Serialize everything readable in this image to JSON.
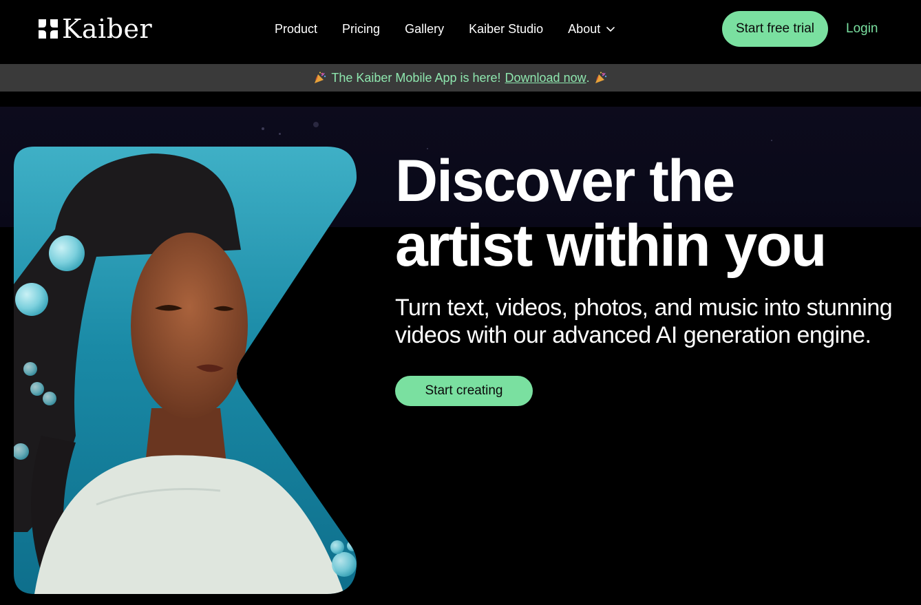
{
  "header": {
    "brand": "Kaiber",
    "nav": [
      {
        "label": "Product"
      },
      {
        "label": "Pricing"
      },
      {
        "label": "Gallery"
      },
      {
        "label": "Kaiber Studio"
      },
      {
        "label": "About",
        "icon": "chevron-down-icon"
      }
    ],
    "trial_label": "Start free trial",
    "login_label": "Login"
  },
  "announcement": {
    "text": "The Kaiber Mobile App is here!",
    "link_label": "Download now",
    "suffix": ".",
    "icon": "party-popper-icon"
  },
  "hero": {
    "headline_line1": "Discover the",
    "headline_line2": "artist within you",
    "subhead_line1": "Turn text, videos, photos, and music into stunning",
    "subhead_line2": "videos with our advanced AI generation engine.",
    "cta_label": "Start creating",
    "image_icon": "portrait-artwork-image"
  },
  "colors": {
    "background": "#000000",
    "accent": "#7ae0a0",
    "announcement_bg": "#3a3a3a",
    "announcement_text": "#8ee6ae",
    "hero_band": "#0d0b1c"
  }
}
